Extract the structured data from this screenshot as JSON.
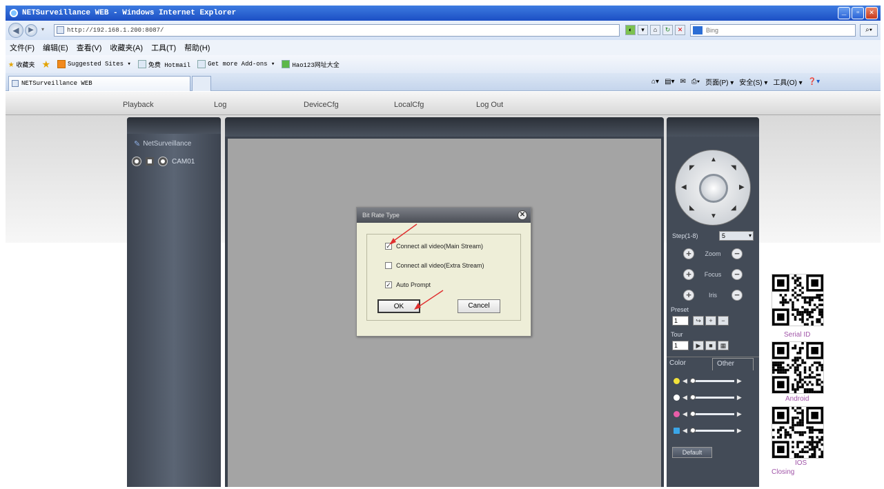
{
  "window": {
    "title": "NETSurveillance WEB - Windows Internet Explorer"
  },
  "address": {
    "url": "http://192.168.1.200:8087/",
    "search_placeholder": "Bing"
  },
  "menu": [
    "文件(F)",
    "编辑(E)",
    "查看(V)",
    "收藏夹(A)",
    "工具(T)",
    "帮助(H)"
  ],
  "favorites": {
    "label": "收藏夹",
    "items": [
      "Suggested Sites ▾",
      "免费 Hotmail",
      "Get more Add-ons ▾",
      "Hao123网址大全"
    ]
  },
  "tab": {
    "title": "NETSurveillance WEB"
  },
  "command_bar": [
    "页面(P) ▾",
    "安全(S) ▾",
    "工具(O) ▾"
  ],
  "nav": [
    "Playback",
    "Log",
    "DeviceCfg",
    "LocalCfg",
    "Log Out"
  ],
  "device_tree": {
    "root": "NetSurveillance",
    "camera": "CAM01"
  },
  "dialog": {
    "title": "Bit Rate Type",
    "options": [
      {
        "label": "Connect all video(Main Stream)",
        "checked": true
      },
      {
        "label": "Connect all video(Extra Stream)",
        "checked": false
      },
      {
        "label": "Auto Prompt",
        "checked": true
      }
    ],
    "ok_label": "OK",
    "cancel_label": "Cancel"
  },
  "ptz": {
    "step_label": "Step(1-8)",
    "step_value": "5",
    "zoom_label": "Zoom",
    "focus_label": "Focus",
    "iris_label": "Iris",
    "preset_label": "Preset",
    "preset_value": "1",
    "tour_label": "Tour",
    "tour_value": "1"
  },
  "color_panel": {
    "tabs": [
      "Color",
      "Other"
    ],
    "default_label": "Default",
    "slider_colors": [
      "#f2e23a",
      "#ffffff",
      "#e85da8",
      "#3aa6e8"
    ]
  },
  "qr": {
    "labels": [
      "Serial ID",
      "Android",
      "IOS"
    ],
    "closing": "Closing"
  }
}
